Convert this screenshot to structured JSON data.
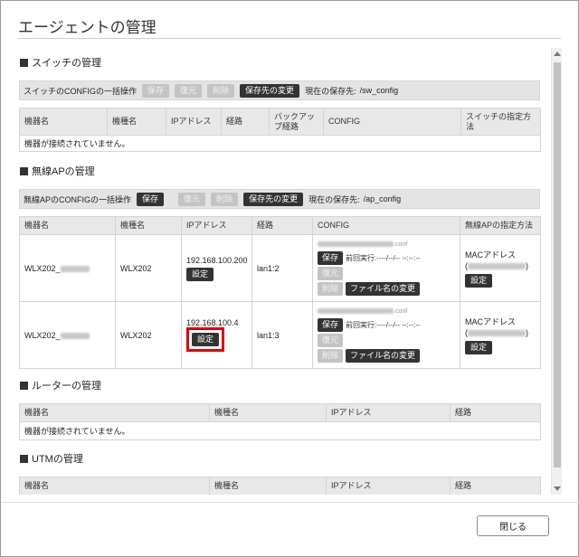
{
  "dialog": {
    "title": "エージェントの管理",
    "close_label": "閉じる"
  },
  "switch": {
    "heading": "スイッチの管理",
    "bulk_label": "スイッチのCONFIGの一括操作",
    "save": "保存",
    "restore": "復元",
    "delete": "削除",
    "change_dest": "保存先の変更",
    "current_dest_label": "現在の保存先:",
    "current_dest_value": "/sw_config",
    "columns": [
      "機器名",
      "機種名",
      "IPアドレス",
      "経路",
      "バックアップ経路",
      "CONFIG",
      "スイッチの指定方法"
    ],
    "empty": "機器が接続されていません。"
  },
  "ap": {
    "heading": "無線APの管理",
    "bulk_label": "無線APのCONFIGの一括操作",
    "save": "保存",
    "restore": "復元",
    "delete": "削除",
    "change_dest": "保存先の変更",
    "current_dest_label": "現在の保存先:",
    "current_dest_value": "/ap_config",
    "columns": [
      "機器名",
      "機種名",
      "IPアドレス",
      "経路",
      "CONFIG",
      "無線APの指定方法"
    ],
    "rows": [
      {
        "name": "WLX202_",
        "model": "WLX202",
        "ip": "192.168.100.200",
        "setting": "設定",
        "route": "lan1:2",
        "config_ext": ".conf",
        "save": "保存",
        "restore": "復元",
        "delete": "削除",
        "last_run": "前回実行:----/--/-- --:--:--",
        "rename": "ファイル名の変更",
        "mac_label": "MACアドレス",
        "mac_open": "(",
        "mac_close": ")",
        "method_setting": "設定"
      },
      {
        "name": "WLX202_",
        "model": "WLX202",
        "ip": "192.168.100.4",
        "setting": "設定",
        "route": "lan1:3",
        "config_ext": ".conf",
        "save": "保存",
        "restore": "復元",
        "delete": "削除",
        "last_run": "前回実行:----/--/-- --:--:--",
        "rename": "ファイル名の変更",
        "mac_label": "MACアドレス",
        "mac_open": "(",
        "mac_close": ")",
        "method_setting": "設定"
      }
    ]
  },
  "router": {
    "heading": "ルーターの管理",
    "columns": [
      "機器名",
      "機種名",
      "IPアドレス",
      "経路"
    ],
    "empty": "機器が接続されていません。"
  },
  "utm": {
    "heading": "UTMの管理",
    "columns": [
      "機器名",
      "機種名",
      "IPアドレス",
      "経路"
    ]
  },
  "icons": {
    "section_marker": "square-bullet-icon",
    "scroll_up": "arrow-up-icon",
    "scroll_down": "arrow-down-icon"
  },
  "colors": {
    "dark_button": "#333333",
    "disabled_button": "#c4c4c4",
    "highlight": "#e00000"
  }
}
